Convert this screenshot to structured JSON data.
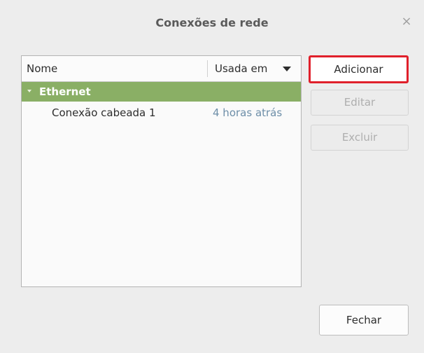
{
  "window": {
    "title": "Conexões de rede",
    "close_glyph": "×"
  },
  "list": {
    "columns": {
      "name": "Nome",
      "used": "Usada em"
    },
    "groups": [
      {
        "label": "Ethernet",
        "connections": [
          {
            "name": "Conexão cabeada 1",
            "used": "4 horas atrás"
          }
        ]
      }
    ]
  },
  "buttons": {
    "add": "Adicionar",
    "edit": "Editar",
    "delete": "Excluir",
    "close": "Fechar"
  },
  "colors": {
    "group_header": "#8aaf65",
    "highlight_box": "#e0202b",
    "time_text": "#6d8ea8"
  },
  "icons": {
    "close": "close-icon",
    "sort": "sort-down-icon",
    "expander": "expander-down-icon"
  }
}
